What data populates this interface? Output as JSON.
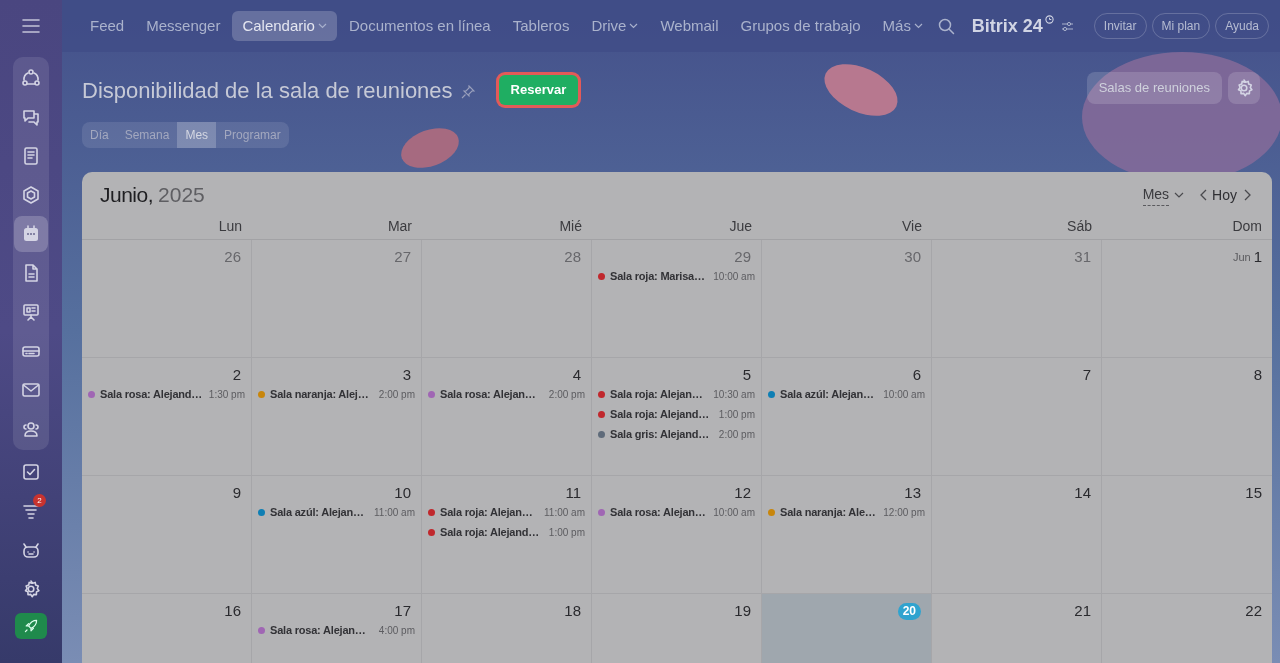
{
  "sidebar": {
    "items": [
      {
        "selected": false
      },
      {
        "selected": false
      },
      {
        "selected": false
      },
      {
        "selected": false
      },
      {
        "selected": true
      },
      {
        "selected": false
      },
      {
        "selected": false
      },
      {
        "selected": false
      },
      {
        "selected": false
      },
      {
        "selected": false
      },
      {
        "selected": false
      },
      {
        "selected": false,
        "badge": "2"
      },
      {
        "selected": false
      },
      {
        "selected": false
      }
    ]
  },
  "nav": {
    "items": [
      {
        "label": "Feed",
        "selected": false,
        "dropdown": false
      },
      {
        "label": "Messenger",
        "selected": false,
        "dropdown": false
      },
      {
        "label": "Calendario",
        "selected": true,
        "dropdown": true
      },
      {
        "label": "Documentos en línea",
        "selected": false,
        "dropdown": false
      },
      {
        "label": "Tableros",
        "selected": false,
        "dropdown": false
      },
      {
        "label": "Drive",
        "selected": false,
        "dropdown": true
      },
      {
        "label": "Webmail",
        "selected": false,
        "dropdown": false
      },
      {
        "label": "Grupos de trabajo",
        "selected": false,
        "dropdown": false
      },
      {
        "label": "Más",
        "selected": false,
        "dropdown": true
      }
    ],
    "logo": {
      "name": "Bitrix",
      "number": "24"
    },
    "buttons": [
      "Invitar",
      "Mi plan",
      "Ayuda"
    ]
  },
  "page": {
    "title": "Disponibilidad de la sala de reuniones",
    "primary_button": "Reservar",
    "rooms_button": "Salas de reuniones",
    "view_tabs": [
      {
        "label": "Día",
        "selected": false
      },
      {
        "label": "Semana",
        "selected": false
      },
      {
        "label": "Mes",
        "selected": true
      },
      {
        "label": "Programar",
        "selected": false
      }
    ]
  },
  "calendar": {
    "month": "Junio,",
    "year": "2025",
    "view_selector": "Mes",
    "today_button": "Hoy",
    "weekdays": [
      "Lun",
      "Mar",
      "Mié",
      "Jue",
      "Vie",
      "Sáb",
      "Dom"
    ],
    "weeks": [
      [
        {
          "number": "26",
          "other_month": true,
          "today": false
        },
        {
          "number": "27",
          "other_month": true,
          "today": false
        },
        {
          "number": "28",
          "other_month": true,
          "today": false
        },
        {
          "number": "29",
          "other_month": true,
          "today": false,
          "events": [
            {
              "color": "#c0282d",
              "title": "Sala roja: Marisa…",
              "time": "10:00 am"
            }
          ]
        },
        {
          "number": "30",
          "other_month": true,
          "today": false
        },
        {
          "number": "31",
          "other_month": true,
          "today": false
        },
        {
          "month_label": "Jun",
          "number": "1",
          "other_month": false,
          "today": false
        }
      ],
      [
        {
          "number": "2",
          "other_month": false,
          "today": false,
          "events": [
            {
              "color": "#a066b4",
              "title": "Sala rosa: Alejand…",
              "time": "1:30 pm"
            }
          ]
        },
        {
          "number": "3",
          "other_month": false,
          "today": false,
          "events": [
            {
              "color": "#c8860c",
              "title": "Sala naranja: Alej…",
              "time": "2:00 pm"
            }
          ]
        },
        {
          "number": "4",
          "other_month": false,
          "today": false,
          "events": [
            {
              "color": "#a066b4",
              "title": "Sala rosa: Alejan…",
              "time": "2:00 pm"
            }
          ]
        },
        {
          "number": "5",
          "other_month": false,
          "today": false,
          "events": [
            {
              "color": "#c0282d",
              "title": "Sala roja: Alejan…",
              "time": "10:30 am"
            },
            {
              "color": "#c0282d",
              "title": "Sala roja: Alejand…",
              "time": "1:00 pm"
            },
            {
              "color": "#5f6b7a",
              "title": "Sala gris: Alejand…",
              "time": "2:00 pm"
            }
          ]
        },
        {
          "number": "6",
          "other_month": false,
          "today": false,
          "events": [
            {
              "color": "#0f7fb4",
              "title": "Sala azúl: Alejan…",
              "time": "10:00 am"
            }
          ]
        },
        {
          "number": "7",
          "other_month": false,
          "today": false
        },
        {
          "number": "8",
          "other_month": false,
          "today": false
        }
      ],
      [
        {
          "number": "9",
          "other_month": false,
          "today": false
        },
        {
          "number": "10",
          "other_month": false,
          "today": false,
          "events": [
            {
              "color": "#0f7fb4",
              "title": "Sala azúl: Alejan…",
              "time": "11:00 am"
            }
          ]
        },
        {
          "number": "11",
          "other_month": false,
          "today": false,
          "events": [
            {
              "color": "#c0282d",
              "title": "Sala roja: Alejan…",
              "time": "11:00 am"
            },
            {
              "color": "#c0282d",
              "title": "Sala roja: Alejand…",
              "time": "1:00 pm"
            }
          ]
        },
        {
          "number": "12",
          "other_month": false,
          "today": false,
          "events": [
            {
              "color": "#a066b4",
              "title": "Sala rosa: Alejan…",
              "time": "10:00 am"
            }
          ]
        },
        {
          "number": "13",
          "other_month": false,
          "today": false,
          "events": [
            {
              "color": "#c8860c",
              "title": "Sala naranja: Ale…",
              "time": "12:00 pm"
            }
          ]
        },
        {
          "number": "14",
          "other_month": false,
          "today": false
        },
        {
          "number": "15",
          "other_month": false,
          "today": false
        }
      ],
      [
        {
          "number": "16",
          "other_month": false,
          "today": false
        },
        {
          "number": "17",
          "other_month": false,
          "today": false,
          "events": [
            {
              "color": "#a066b4",
              "title": "Sala rosa: Alejan…",
              "time": "4:00 pm"
            }
          ]
        },
        {
          "number": "18",
          "other_month": false,
          "today": false
        },
        {
          "number": "19",
          "other_month": false,
          "today": false
        },
        {
          "number": "20",
          "other_month": false,
          "today": true
        },
        {
          "number": "21",
          "other_month": false,
          "today": false
        },
        {
          "number": "22",
          "other_month": false,
          "today": false
        }
      ]
    ]
  }
}
